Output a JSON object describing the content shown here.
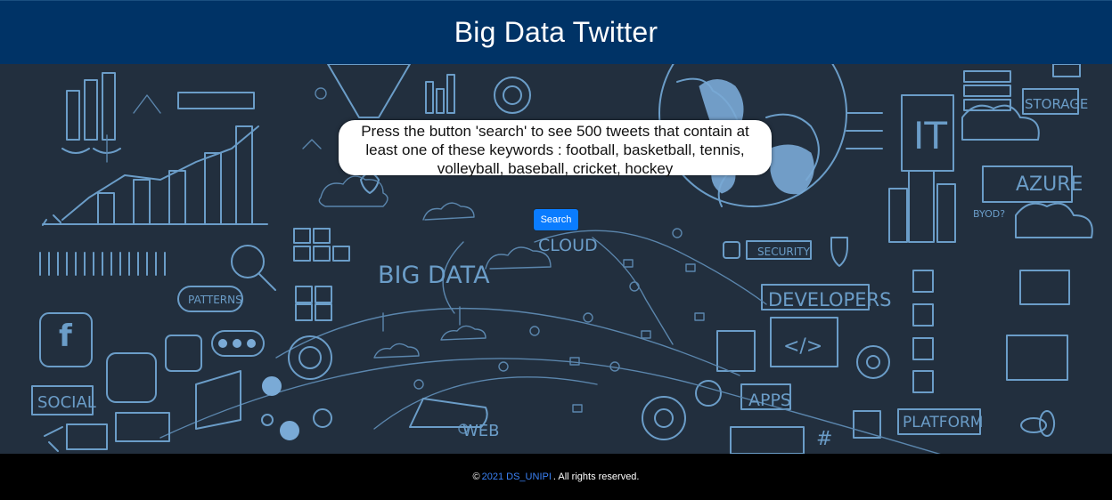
{
  "header": {
    "title": "Big Data Twitter"
  },
  "main": {
    "instructions": "Press the button 'search' to see 500 tweets that contain at least one of these keywords : football, basketball, tennis, volleyball, baseball, cricket, hockey",
    "search_label": "Search"
  },
  "background_labels": {
    "big_data": "BIG DATA",
    "cloud": "CLOUD",
    "developers": "DEVELOPERS",
    "security": "SECURITY",
    "apps": "APPS",
    "platform": "PLATFORM",
    "social": "SOCIAL",
    "patterns": "PATTERNS",
    "web": "WEB",
    "storage": "STORAGE",
    "azure": "AZURE",
    "it": "IT",
    "byod": "BYOD?",
    "code": "</>",
    "hash": "#"
  },
  "footer": {
    "copyright_symbol": "©",
    "link_text": "2021 DS_UNIPI",
    "suffix": ". All rights reserved."
  },
  "colors": {
    "header_bg": "#003366",
    "hero_bg": "#222f3e",
    "doodle": "#6b9dc8",
    "button": "#0a7cff",
    "footer_bg": "#000000",
    "footer_link": "#3b82f6"
  }
}
